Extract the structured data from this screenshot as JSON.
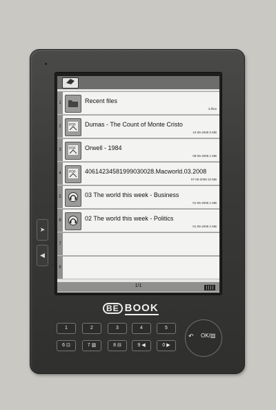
{
  "logo": {
    "be": "BE",
    "book": "BOOK"
  },
  "side_buttons": {
    "up": "➤",
    "down": "◀"
  },
  "files": [
    {
      "num": "1",
      "title": "Recent files",
      "meta": "5 files",
      "icon": "folder-icon"
    },
    {
      "num": "2",
      "title": "Dumas - The Count of Monte Cristo",
      "meta": "10-05-2008  5 MB",
      "icon": "pdf-icon"
    },
    {
      "num": "3",
      "title": "Orwell - 1984",
      "meta": "08-05-2008  1 MB",
      "icon": "pdf-icon"
    },
    {
      "num": "4",
      "title": "40614234581999030028.Macworld.03.2008",
      "meta": "07-05-2008  23 MB",
      "icon": "pdf-icon"
    },
    {
      "num": "5",
      "title": "03 The world this week - Business",
      "meta": "01-05-2008  1 MB",
      "icon": "audio-icon"
    },
    {
      "num": "6",
      "title": "02 The world this week - Politics",
      "meta": "01-05-2008  2 MB",
      "icon": "audio-icon"
    },
    {
      "num": "7",
      "title": "",
      "meta": "",
      "icon": ""
    },
    {
      "num": "8",
      "title": "",
      "meta": "",
      "icon": ""
    }
  ],
  "page_indicator": "1/1",
  "keypad": {
    "row1": [
      "1",
      "2",
      "3",
      "4",
      "5"
    ],
    "row2": [
      "6 ⊡",
      "7 ▥",
      "8 ⊟",
      "9 ◀",
      "0 ▶"
    ]
  },
  "nav": {
    "back": "↶",
    "ok": "OK/▥"
  }
}
